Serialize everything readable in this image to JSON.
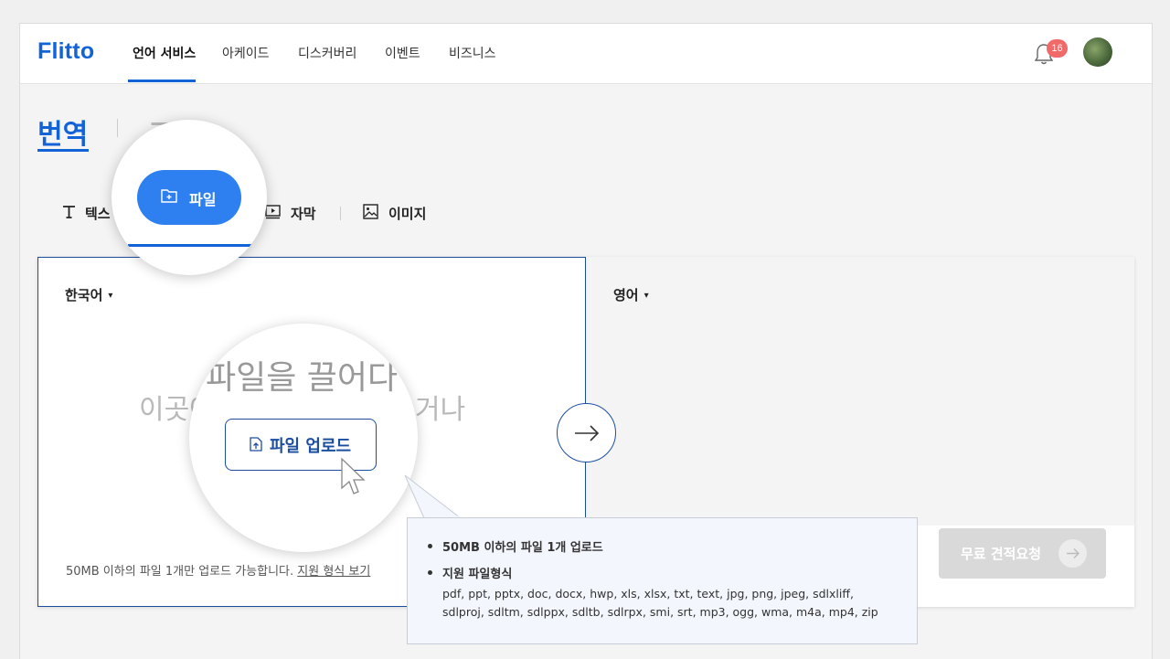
{
  "nav": {
    "logo": "Flitto",
    "items": [
      "언어 서비스",
      "아케이드",
      "디스커버리",
      "이벤트",
      "비즈니스"
    ],
    "active_index": 0,
    "notification_count": "16"
  },
  "header_tabs": {
    "translate": "번역",
    "ghost_tab": "교정"
  },
  "sub_tabs": {
    "text": "텍스",
    "file": "파일",
    "subtitle": "자막",
    "image": "이미지"
  },
  "source": {
    "language": "한국어",
    "drop_line1": "파일을 끌어다",
    "drop_line2": "이곳에 놓거나",
    "drop_line2_left": "이곳에",
    "drop_line2_right": "거나",
    "upload_label": "파일 업로드",
    "footnote": "50MB 이하의 파일 1개만 업로드 가능합니다.",
    "footnote_link": "지원 형식 보기"
  },
  "target": {
    "language": "영어"
  },
  "quote_button": "무료 견적요청",
  "tooltip": {
    "item1": "50MB 이하의 파일 1개 업로드",
    "item2": "지원 파일형식",
    "formats_line1": "pdf, ppt, pptx, doc, docx, hwp, xls, xlsx, txt, text, jpg, png, jpeg, sdlxliff,",
    "formats_line2": "sdlproj, sdltm, sdlppx, sdltb, sdlrpx, smi, srt, mp3, ogg, wma, m4a, mp4, zip"
  },
  "colors": {
    "brand": "#1262d8",
    "accent_pill": "#2e7ff0",
    "badge": "#f06a6a",
    "disabled": "#d9d9d9"
  }
}
